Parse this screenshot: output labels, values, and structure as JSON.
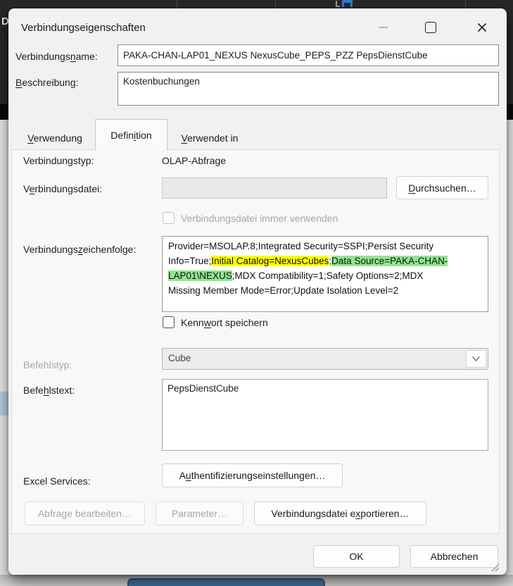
{
  "window": {
    "title": "Verbindungseigenschaften"
  },
  "background": {
    "partial_letter": "D"
  },
  "header_fields": {
    "name": {
      "label_pre": "Verbindungs",
      "label_accel": "n",
      "label_post": "ame:",
      "value": "PAKA-CHAN-LAP01_NEXUS NexusCube_PEPS_PZZ PepsDienstCube"
    },
    "description": {
      "label_pre": "",
      "label_accel": "B",
      "label_post": "eschreibung:",
      "value": "Kostenbuchungen"
    }
  },
  "tabs": [
    {
      "pre": "",
      "accel": "V",
      "post": "erwendung",
      "active": false
    },
    {
      "pre": "Defin",
      "accel": "i",
      "post": "tion",
      "active": true
    },
    {
      "pre": "",
      "accel": "V",
      "post": "erwendet in",
      "active": false
    }
  ],
  "definition": {
    "connection_type": {
      "label": "Verbindungstyp:",
      "value": "OLAP-Abfrage"
    },
    "connection_file": {
      "label_pre": "V",
      "label_accel": "e",
      "label_post": "rbindungsdatei:",
      "value": "",
      "browse_pre": "",
      "browse_accel": "D",
      "browse_post": "urchsuchen…"
    },
    "always_use_file": {
      "label": "Verbindungsdatei immer verwenden",
      "checked": false
    },
    "connection_string": {
      "label_pre": "Verbindungs",
      "label_accel": "z",
      "label_post": "eichenfolge:",
      "segments": [
        {
          "text": "Provider=MSOLAP.8;Integrated Security=SSPI;Persist Security\nInfo=True;",
          "hl": "none"
        },
        {
          "text": "Initial Catalog=NexusCubes",
          "hl": "yellow"
        },
        {
          "text": ";",
          "hl": "none"
        },
        {
          "text": "Data Source=PAKA-CHAN-\nLAP01\\NEXUS",
          "hl": "green"
        },
        {
          "text": ";MDX Compatibility=1;Safety Options=2;MDX\nMissing Member Mode=Error;Update Isolation Level=2",
          "hl": "none"
        }
      ]
    },
    "save_password": {
      "label_pre": "Kenn",
      "label_accel": "w",
      "label_post": "ort speichern",
      "checked": false
    },
    "command_type": {
      "label": "Befehlstyp:",
      "value": "Cube"
    },
    "command_text": {
      "label_pre": "Befe",
      "label_accel": "h",
      "label_post": "lstext:",
      "value": "PepsDienstCube"
    },
    "excel_services": {
      "label": "Excel Services:",
      "button_pre": "A",
      "button_accel": "u",
      "button_post": "thentifizierungseinstellungen…"
    },
    "buttons": {
      "edit_query": "Abfrage bearbeiten…",
      "parameters": "Parameter…",
      "export_pre": "Verbindungsdatei e",
      "export_accel": "x",
      "export_post": "portieren…"
    }
  },
  "footer": {
    "ok": "OK",
    "cancel": "Abbrechen"
  },
  "colors": {
    "highlight_yellow": "#ffff00",
    "highlight_green": "#8fe78f",
    "bottom_tab_blue": "#40719e"
  }
}
